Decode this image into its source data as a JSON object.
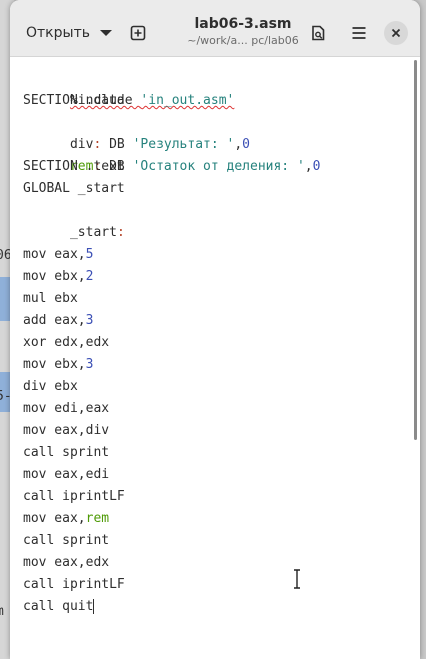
{
  "header": {
    "open_label": "Открыть",
    "title": "lab06-3.asm",
    "subtitle": "~/work/a... pc/lab06"
  },
  "background": {
    "peek_1": "06",
    "peek_2": "5-",
    "peek_3": "m"
  },
  "editor": {
    "lines": [
      {
        "t1": "%include ",
        "t2": "'in_out.asm'"
      },
      {
        "t1": "SECTION .data"
      },
      {
        "t1": "div",
        "t2": ":",
        " t3": ""
      },
      {
        "t1": "rem"
      },
      {
        "t1": "SECTION .text"
      },
      {
        "t1": "GLOBAL _start"
      },
      {
        "t1": "_start",
        "t2": ":"
      }
    ],
    "l0_a": "%include ",
    "l0_b": "'in_out.asm'",
    "l1": "SECTION .data",
    "l2_label": "div",
    "l2_colon": ":",
    "l2_mid": " DB ",
    "l2_str": "'Результат: '",
    "l2_comma": ",",
    "l2_num": "0",
    "l3_label": "rem",
    "l3_colon": ":",
    "l3_mid": " DB ",
    "l3_str": "'Остаток от деления: '",
    "l3_comma": ",",
    "l3_num": "0",
    "l4": "SECTION .text",
    "l5": "GLOBAL _start",
    "l6_label": "_start",
    "l6_colon": ":",
    "l8_a": "mov eax,",
    "l8_n": "5",
    "l9_a": "mov ebx,",
    "l9_n": "2",
    "l10": "mul ebx",
    "l11_a": "add eax,",
    "l11_n": "3",
    "l12": "xor edx,edx",
    "l13_a": "mov ebx,",
    "l13_n": "3",
    "l14": "div ebx",
    "l15": "mov edi,eax",
    "l16": "mov eax,div",
    "l17": "call sprint",
    "l18": "mov eax,edi",
    "l19": "call iprintLF",
    "l20_a": "mov eax,",
    "l20_b": "rem",
    "l21": "call sprint",
    "l22": "mov eax,edx",
    "l23": "call iprintLF",
    "l24": "call quit"
  }
}
